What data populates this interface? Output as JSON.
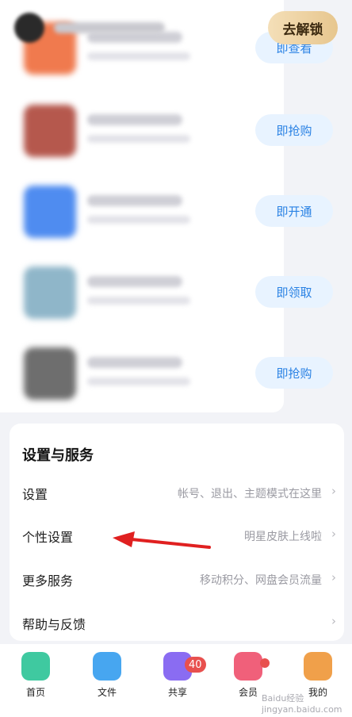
{
  "header": {
    "unlock_button": "去解锁"
  },
  "promo_list": {
    "items": [
      {
        "action": "即查看",
        "thumb_color": "#f07a4e"
      },
      {
        "action": "即抢购",
        "thumb_color": "#b5584d"
      },
      {
        "action": "即开通",
        "thumb_color": "#4f8cf0"
      },
      {
        "action": "即领取",
        "thumb_color": "#8fb6c9"
      },
      {
        "action": "即抢购",
        "thumb_color": "#6e6e6e"
      }
    ]
  },
  "settings": {
    "title": "设置与服务",
    "rows": [
      {
        "label": "设置",
        "desc": "帐号、退出、主题模式在这里"
      },
      {
        "label": "个性设置",
        "desc": "明星皮肤上线啦"
      },
      {
        "label": "更多服务",
        "desc": "移动积分、网盘会员流量"
      },
      {
        "label": "帮助与反馈",
        "desc": ""
      }
    ],
    "chevron": "›"
  },
  "bottom_nav": {
    "items": [
      {
        "label": "首页",
        "icon": "home-icon",
        "color": "#3fc9a0"
      },
      {
        "label": "文件",
        "icon": "folder-icon",
        "color": "#47a6f0"
      },
      {
        "label": "共享",
        "icon": "share-icon",
        "color": "#8a6cf2",
        "badge": "40"
      },
      {
        "label": "会员",
        "icon": "member-icon",
        "color": "#f0607a"
      },
      {
        "label": "我的",
        "icon": "profile-icon",
        "color": "#f0a04a"
      }
    ]
  },
  "watermark": "Baidu经验 jingyan.baidu.com",
  "colors": {
    "accent": "#2a82e4",
    "unlock_gradient": [
      "#f4dfb8",
      "#e7c68e"
    ],
    "arrow": "#e02020"
  }
}
